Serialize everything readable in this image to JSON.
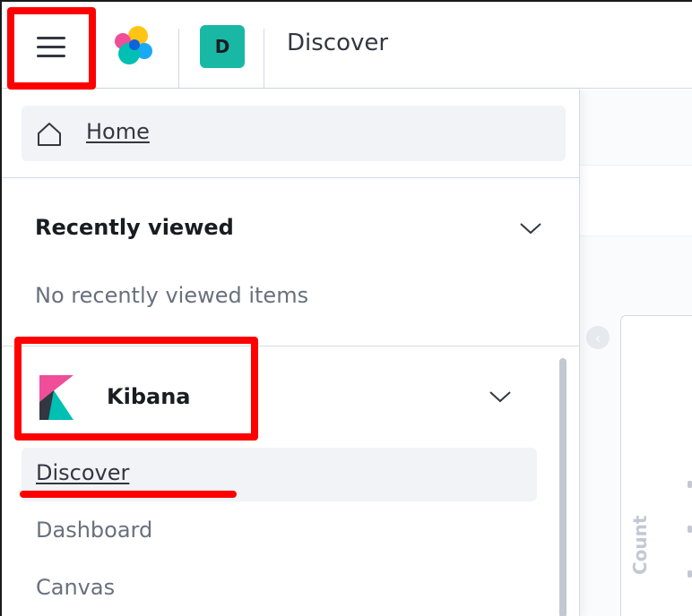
{
  "header": {
    "menu_button_name": "menu-icon",
    "space_initial": "D",
    "breadcrumb": "Discover"
  },
  "nav": {
    "home_label": "Home",
    "recently_viewed": {
      "title": "Recently viewed",
      "empty_text": "No recently viewed items"
    },
    "kibana": {
      "title": "Kibana",
      "items": [
        {
          "label": "Discover",
          "active": true
        },
        {
          "label": "Dashboard",
          "active": false
        },
        {
          "label": "Canvas",
          "active": false
        }
      ]
    }
  },
  "background": {
    "axis_label": "Count"
  },
  "colors": {
    "accent_teal": "#19b8a5",
    "highlight_red": "#ff0000",
    "kibana_pink": "#f04e98",
    "kibana_teal": "#00bfb3",
    "text_dark": "#1a1c21",
    "text_muted": "#69707d"
  }
}
